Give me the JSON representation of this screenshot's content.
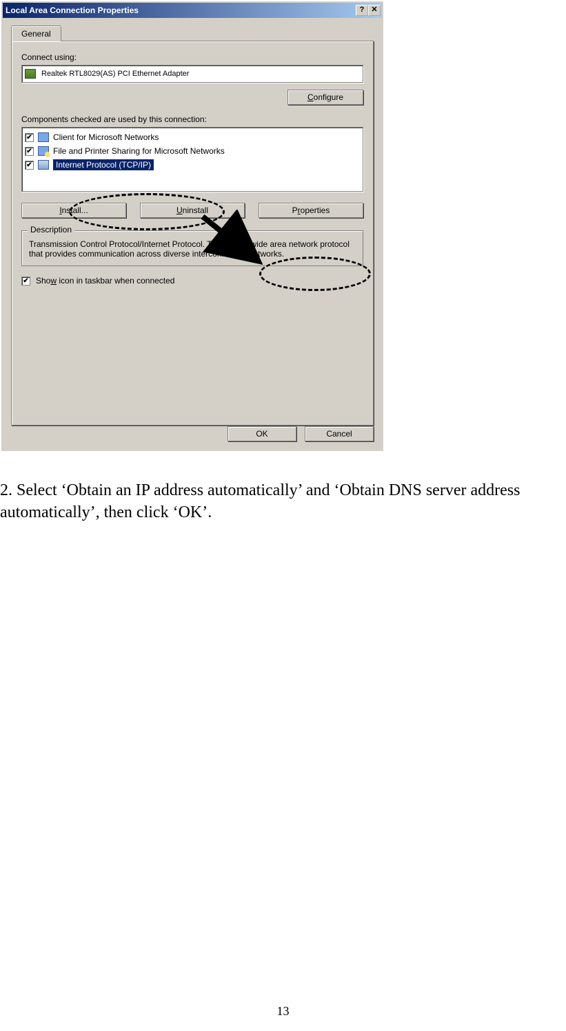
{
  "dialog": {
    "title": "Local Area Connection Properties",
    "tabs": {
      "general": "General"
    },
    "connect_using_label": "Connect using:",
    "adapter_name": "Realtek RTL8029(AS) PCI Ethernet Adapter",
    "configure_btn": "Configure",
    "components_label": "Components checked are used by this connection:",
    "components": [
      {
        "label": "Client for Microsoft Networks",
        "checked": true,
        "selected": false
      },
      {
        "label": "File and Printer Sharing for Microsoft Networks",
        "checked": true,
        "selected": false
      },
      {
        "label": "Internet Protocol (TCP/IP)",
        "checked": true,
        "selected": true
      }
    ],
    "install_btn": "Install...",
    "uninstall_btn": "Uninstall",
    "properties_btn": "Properties",
    "description_label": "Description",
    "description_text": "Transmission Control Protocol/Internet Protocol. The default wide area network protocol that provides communication across diverse interconnected networks.",
    "show_icon_label": "Show icon in taskbar when connected",
    "show_icon_checked": true,
    "ok_btn": "OK",
    "cancel_btn": "Cancel"
  },
  "instruction_text": "2. Select ‘Obtain an IP address automatically’ and ‘Obtain DNS server address automatically’, then click ‘OK’.",
  "page_number": "13"
}
